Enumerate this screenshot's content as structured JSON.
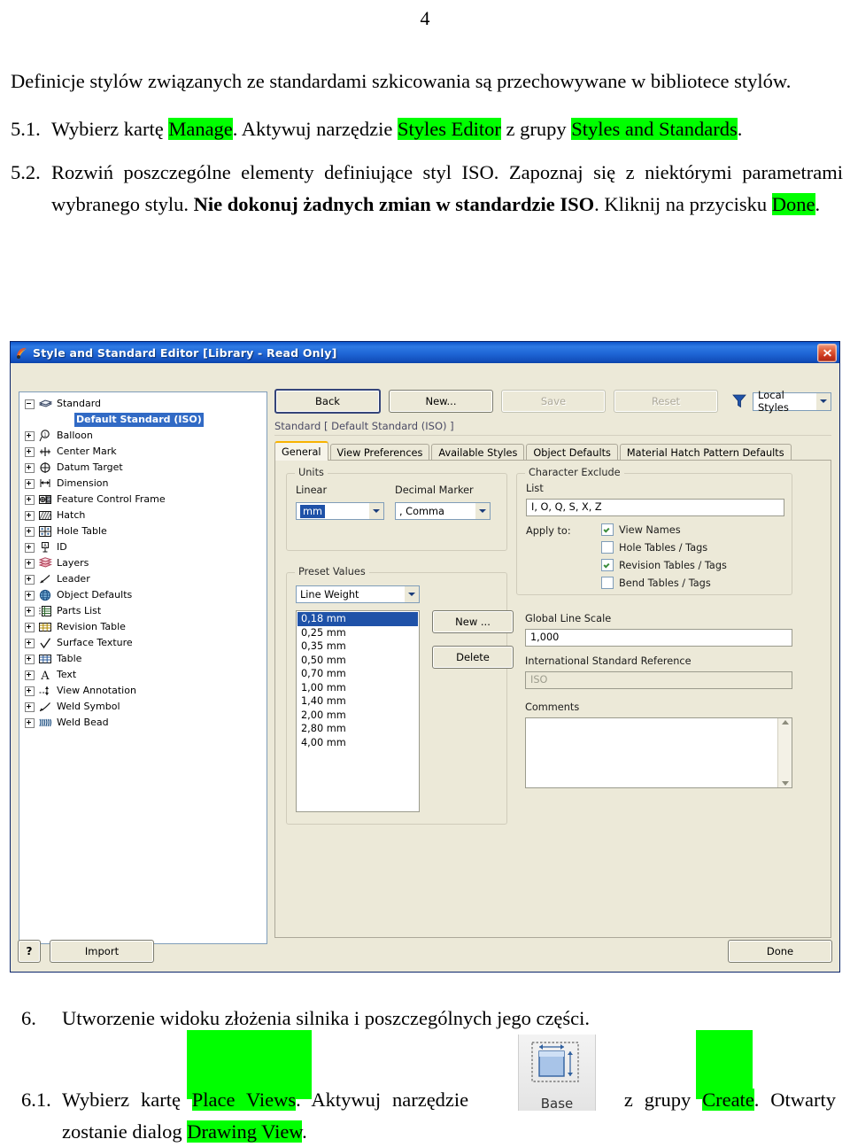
{
  "document": {
    "page_number": "4",
    "intro_paragraph": "Definicje stylów związanych ze standardami szkicowania są przechowywane w bibliotece stylów.",
    "steps": [
      {
        "num": "5.1.",
        "parts": [
          {
            "t": "Wybierz kartę ",
            "hl": false
          },
          {
            "t": "Manage",
            "hl": true
          },
          {
            "t": ". Aktywuj narzędzie ",
            "hl": false
          },
          {
            "t": "Styles Editor",
            "hl": true
          },
          {
            "t": " z grupy ",
            "hl": false
          },
          {
            "t": "Styles and Standards",
            "hl": true
          },
          {
            "t": ".",
            "hl": false
          }
        ]
      },
      {
        "num": "5.2.",
        "parts": [
          {
            "t": "Rozwiń poszczególne elementy definiujące styl ISO. Zapoznaj się z niektórymi parametrami wybranego stylu. ",
            "hl": false
          },
          {
            "t": "Nie dokonuj żadnych zmian w standardzie ISO",
            "hl": false,
            "bold": true
          },
          {
            "t": ". Kliknij na przycisku ",
            "hl": false
          },
          {
            "t": "Done",
            "hl": true
          },
          {
            "t": ".",
            "hl": false
          }
        ]
      }
    ],
    "step6_num": "6.",
    "step6_text": "Utworzenie widoku złożenia silnika i poszczególnych jego części.",
    "step61_num": "6.1.",
    "step61_parts": [
      {
        "t": "Wybierz kartę ",
        "hl": false
      },
      {
        "t": "Place Views",
        "hl": true
      },
      {
        "t": ". Aktywuj narzędzie ",
        "hl": false
      }
    ],
    "step61_tail": [
      {
        "t": " z grupy ",
        "hl": false
      },
      {
        "t": "Create",
        "hl": true
      },
      {
        "t": ". Otwarty zostanie dialog ",
        "hl": false
      },
      {
        "t": "Drawing View",
        "hl": true
      },
      {
        "t": ".",
        "hl": false
      }
    ],
    "highlight_color": "#00ff00"
  },
  "ribbon_button": {
    "label": "Base",
    "icon": "base-view-icon"
  },
  "dialog": {
    "title": "Style and Standard Editor [Library - Read Only]",
    "titlebar_color": "#1f66d6",
    "close_icon": "close-icon",
    "app_icon": "inventor-icon",
    "toolbar": {
      "back": "Back",
      "new": "New...",
      "save": "Save",
      "reset": "Reset",
      "filter_icon": "filter-icon",
      "filter_value": "Local Styles"
    },
    "breadcrumb": "Standard [ Default Standard (ISO) ]",
    "tabs": [
      {
        "label": "General",
        "active": true
      },
      {
        "label": "View Preferences",
        "active": false
      },
      {
        "label": "Available Styles",
        "active": false
      },
      {
        "label": "Object Defaults",
        "active": false
      },
      {
        "label": "Material Hatch Pattern Defaults",
        "active": false
      }
    ],
    "tree": [
      {
        "label": "Standard",
        "icon": "standard-icon",
        "expander": "minus",
        "level": 0
      },
      {
        "label": "Default Standard (ISO)",
        "icon": "none",
        "expander": "none",
        "level": 1,
        "selected": true
      },
      {
        "label": "Balloon",
        "icon": "balloon-icon",
        "expander": "plus",
        "level": 0
      },
      {
        "label": "Center Mark",
        "icon": "center-mark-icon",
        "expander": "plus",
        "level": 0
      },
      {
        "label": "Datum Target",
        "icon": "datum-target-icon",
        "expander": "plus",
        "level": 0
      },
      {
        "label": "Dimension",
        "icon": "dimension-icon",
        "expander": "plus",
        "level": 0
      },
      {
        "label": "Feature Control Frame",
        "icon": "feature-control-frame-icon",
        "expander": "plus",
        "level": 0
      },
      {
        "label": "Hatch",
        "icon": "hatch-icon",
        "expander": "plus",
        "level": 0
      },
      {
        "label": "Hole Table",
        "icon": "hole-table-icon",
        "expander": "plus",
        "level": 0
      },
      {
        "label": "ID",
        "icon": "id-icon",
        "expander": "plus",
        "level": 0
      },
      {
        "label": "Layers",
        "icon": "layers-icon",
        "expander": "plus",
        "level": 0
      },
      {
        "label": "Leader",
        "icon": "leader-icon",
        "expander": "plus",
        "level": 0
      },
      {
        "label": "Object Defaults",
        "icon": "object-defaults-icon",
        "expander": "plus",
        "level": 0
      },
      {
        "label": "Parts List",
        "icon": "parts-list-icon",
        "expander": "plus",
        "level": 0
      },
      {
        "label": "Revision Table",
        "icon": "revision-table-icon",
        "expander": "plus",
        "level": 0
      },
      {
        "label": "Surface Texture",
        "icon": "surface-texture-icon",
        "expander": "plus",
        "level": 0
      },
      {
        "label": "Table",
        "icon": "table-icon",
        "expander": "plus",
        "level": 0
      },
      {
        "label": "Text",
        "icon": "text-icon",
        "expander": "plus",
        "level": 0
      },
      {
        "label": "View Annotation",
        "icon": "view-annotation-icon",
        "expander": "plus",
        "level": 0
      },
      {
        "label": "Weld Symbol",
        "icon": "weld-symbol-icon",
        "expander": "plus",
        "level": 0
      },
      {
        "label": "Weld Bead",
        "icon": "weld-bead-icon",
        "expander": "plus",
        "level": 0
      }
    ],
    "units": {
      "group_title": "Units",
      "linear_label": "Linear",
      "linear_value": "mm",
      "decimal_label": "Decimal Marker",
      "decimal_value": ", Comma"
    },
    "preset_values": {
      "group_title": "Preset Values",
      "type_value": "Line Weight",
      "items": [
        "0,18 mm",
        "0,25 mm",
        "0,35 mm",
        "0,50 mm",
        "0,70 mm",
        "1,00 mm",
        "1,40 mm",
        "2,00 mm",
        "2,80 mm",
        "4,00 mm"
      ],
      "selected_index": 0,
      "new_button": "New ...",
      "delete_button": "Delete"
    },
    "character_exclude": {
      "group_title": "Character Exclude",
      "list_label": "List",
      "list_value": "I, O, Q, S, X, Z",
      "apply_label": "Apply to:",
      "options": [
        {
          "label": "View Names",
          "checked": true
        },
        {
          "label": "Hole Tables / Tags",
          "checked": false
        },
        {
          "label": "Revision Tables / Tags",
          "checked": true
        },
        {
          "label": "Bend Tables / Tags",
          "checked": false
        }
      ]
    },
    "global_line_scale": {
      "label": "Global Line Scale",
      "value": "1,000"
    },
    "international_standard": {
      "label": "International Standard Reference",
      "value": "ISO"
    },
    "comments": {
      "label": "Comments",
      "value": ""
    },
    "footer": {
      "help_label": "?",
      "import_button": "Import",
      "done_button": "Done"
    }
  }
}
